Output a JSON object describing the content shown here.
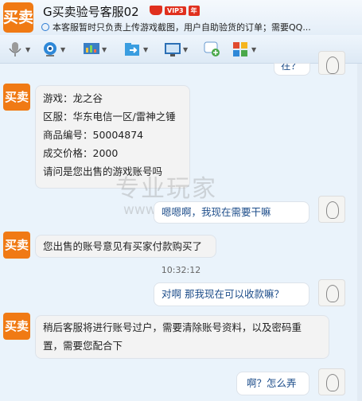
{
  "window": {
    "logo_text": "买卖",
    "title": "G买卖验号客服02",
    "vip_badge": "VIP3",
    "vip_year": "年",
    "notice": "本客服暂时只负责上传游戏截图，用户自助验货的订单；需要QQ..."
  },
  "toolbar": {
    "items": [
      {
        "name": "voice",
        "color": "#8a8a8a"
      },
      {
        "name": "video",
        "color": "#2e88d8"
      },
      {
        "name": "remote-desktop",
        "color": "#3a7fc4"
      },
      {
        "name": "file-transfer",
        "color": "#3a9de0"
      },
      {
        "name": "screen-share",
        "color": "#2b6fb5"
      },
      {
        "name": "add-app",
        "color": "#4aa84a"
      },
      {
        "name": "apps",
        "color": "#e04a2e"
      }
    ]
  },
  "messages": {
    "top_partial": "在？",
    "order_info": {
      "lines": [
        "游戏：龙之谷",
        "区服：华东电信一区/雷神之锤",
        "商品编号：50004874",
        "成交价格：2000",
        "请问是您出售的游戏账号吗"
      ]
    },
    "reply1": "嗯嗯啊，我现在需要干嘛",
    "agent2": "您出售的账号意见有买家付款购买了",
    "timestamp": "10:32:12",
    "reply2": "对啊 那我现在可以收款嘛？",
    "agent3": [
      "稍后客服将进行账号过户，需要清除账号资料，以及密码重",
      "置，需要您配合下"
    ],
    "reply3": "啊？怎么弄"
  },
  "watermark": {
    "text": "专业玩家",
    "url": "www.zhuanyewanjia.com"
  }
}
